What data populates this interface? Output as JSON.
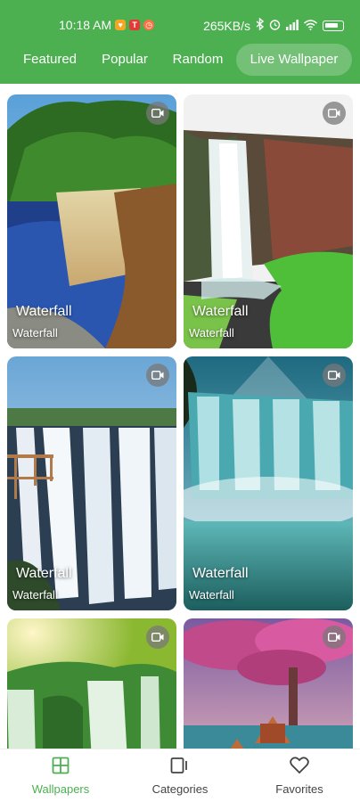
{
  "status_bar": {
    "time": "10:18 AM",
    "network_speed": "265KB/s",
    "icons": [
      "heart-badge-icon",
      "t-badge-icon",
      "alarm-badge-icon",
      "bluetooth-icon",
      "alarm-clock-icon",
      "signal-icon",
      "wifi-icon",
      "battery-icon"
    ]
  },
  "tabs": [
    {
      "label": "Featured",
      "active": false
    },
    {
      "label": "Popular",
      "active": false
    },
    {
      "label": "Random",
      "active": false
    },
    {
      "label": "Live Wallpaper",
      "active": true
    }
  ],
  "cards": [
    {
      "title": "Waterfall",
      "subtitle": "Waterfall"
    },
    {
      "title": "Waterfall",
      "subtitle": "Waterfall"
    },
    {
      "title": "Waterfall",
      "subtitle": "Waterfall"
    },
    {
      "title": "Waterfall",
      "subtitle": "Waterfall"
    },
    {
      "title": "",
      "subtitle": ""
    },
    {
      "title": "",
      "subtitle": ""
    }
  ],
  "bottom_nav": [
    {
      "label": "Wallpapers",
      "icon": "grid-icon",
      "active": true
    },
    {
      "label": "Categories",
      "icon": "categories-icon",
      "active": false
    },
    {
      "label": "Favorites",
      "icon": "heart-icon",
      "active": false
    }
  ],
  "colors": {
    "accent": "#4caf50"
  }
}
